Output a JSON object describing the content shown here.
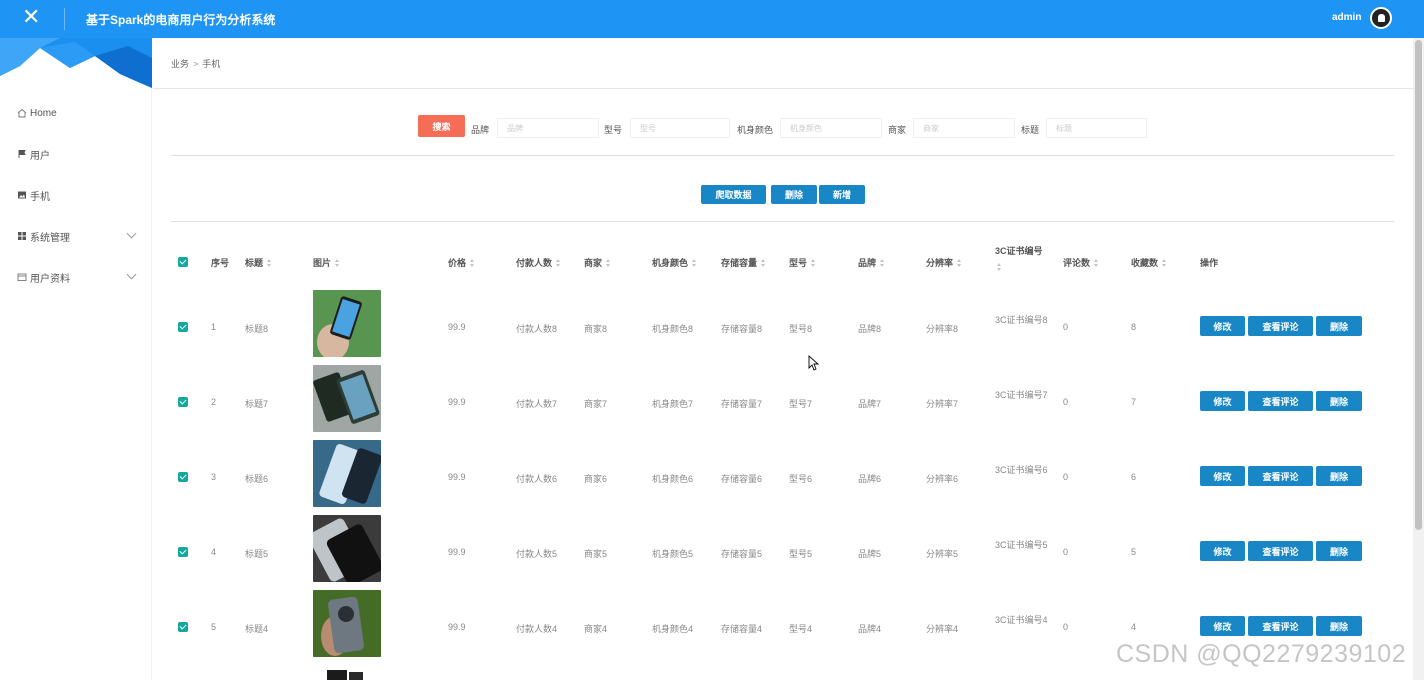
{
  "header": {
    "close_icon": "close-icon",
    "title": "基于Spark的电商用户行为分析系统",
    "user": "admin"
  },
  "sidebar": {
    "items": [
      {
        "label": "Home",
        "icon": "home-icon"
      },
      {
        "label": "用户",
        "icon": "flag-icon"
      },
      {
        "label": "手机",
        "icon": "image-icon"
      },
      {
        "label": "系统管理",
        "icon": "grid-icon",
        "has_children": true
      },
      {
        "label": "用户资料",
        "icon": "card-icon",
        "has_children": true
      }
    ]
  },
  "breadcrumb": {
    "parent": "业务",
    "sep": ">",
    "current": "手机"
  },
  "search": {
    "button": "搜索",
    "fields": [
      {
        "label": "品牌",
        "placeholder": "品牌"
      },
      {
        "label": "型号",
        "placeholder": "型号"
      },
      {
        "label": "机身颜色",
        "placeholder": "机身颜色"
      },
      {
        "label": "商家",
        "placeholder": "商家"
      },
      {
        "label": "标题",
        "placeholder": "标题"
      }
    ]
  },
  "toolbar": {
    "crawl": "爬取数据",
    "delete": "删除",
    "add": "新增"
  },
  "table": {
    "columns": [
      "序号",
      "标题",
      "图片",
      "价格",
      "付款人数",
      "商家",
      "机身颜色",
      "存储容量",
      "型号",
      "品牌",
      "分辨率",
      "3C证书编号",
      "评论数",
      "收藏数",
      "操作"
    ],
    "rows": [
      {
        "no": "1",
        "title": "标题8",
        "price": "99.9",
        "payers": "付款人数8",
        "merchant": "商家8",
        "color": "机身颜色8",
        "storage": "存储容量8",
        "model": "型号8",
        "brand": "品牌8",
        "resolution": "分辨率8",
        "cert": "3C证书编号8",
        "comments": "0",
        "favorites": "8"
      },
      {
        "no": "2",
        "title": "标题7",
        "price": "99.9",
        "payers": "付款人数7",
        "merchant": "商家7",
        "color": "机身颜色7",
        "storage": "存储容量7",
        "model": "型号7",
        "brand": "品牌7",
        "resolution": "分辨率7",
        "cert": "3C证书编号7",
        "comments": "0",
        "favorites": "7"
      },
      {
        "no": "3",
        "title": "标题6",
        "price": "99.9",
        "payers": "付款人数6",
        "merchant": "商家6",
        "color": "机身颜色6",
        "storage": "存储容量6",
        "model": "型号6",
        "brand": "品牌6",
        "resolution": "分辨率6",
        "cert": "3C证书编号6",
        "comments": "0",
        "favorites": "6"
      },
      {
        "no": "4",
        "title": "标题5",
        "price": "99.9",
        "payers": "付款人数5",
        "merchant": "商家5",
        "color": "机身颜色5",
        "storage": "存储容量5",
        "model": "型号5",
        "brand": "品牌5",
        "resolution": "分辨率5",
        "cert": "3C证书编号5",
        "comments": "0",
        "favorites": "5"
      },
      {
        "no": "5",
        "title": "标题4",
        "price": "99.9",
        "payers": "付款人数4",
        "merchant": "商家4",
        "color": "机身颜色4",
        "storage": "存储容量4",
        "model": "型号4",
        "brand": "品牌4",
        "resolution": "分辨率4",
        "cert": "3C证书编号4",
        "comments": "0",
        "favorites": "4"
      }
    ],
    "actions": {
      "edit": "修改",
      "view_comments": "查看评论",
      "delete": "删除"
    }
  },
  "watermark": "CSDN @QQ2279239102",
  "colors": {
    "header": "#1e94f5",
    "search_button": "#f56c57",
    "action_button": "#1987c6",
    "checkbox": "#13a89e"
  }
}
